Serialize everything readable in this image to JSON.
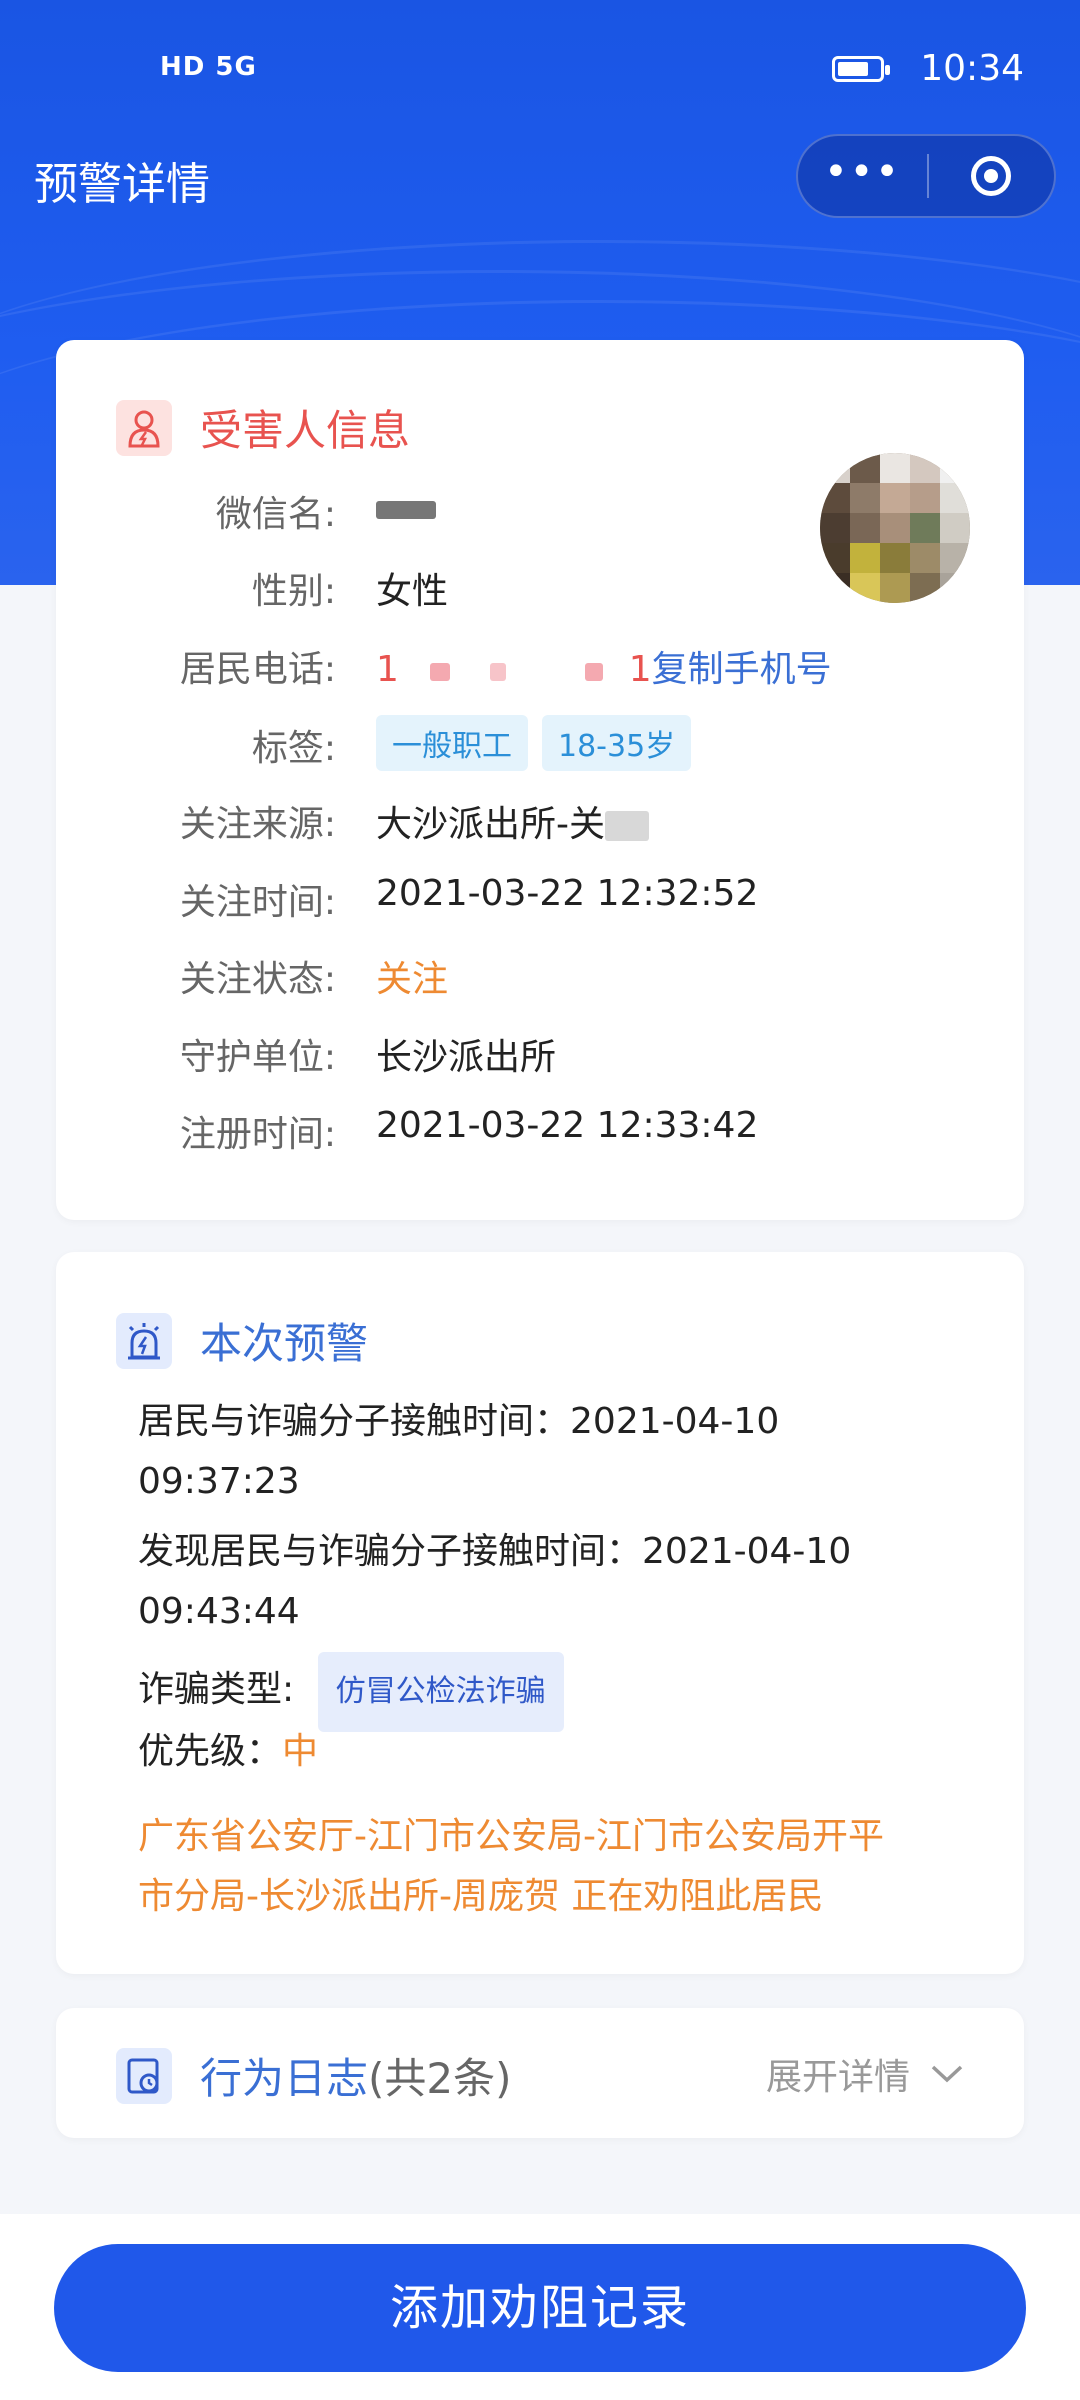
{
  "status_bar": {
    "network": "HD 5G",
    "time": "10:34"
  },
  "nav": {
    "title": "预警详情",
    "more_icon": "more-dots-icon",
    "target_icon": "mini-program-close-icon"
  },
  "victim_section": {
    "title": "受害人信息",
    "fields": [
      {
        "label": "微信名:",
        "value": ""
      },
      {
        "label": "性别:",
        "value": "女性"
      },
      {
        "label": "居民电话:",
        "value_prefix": "1",
        "value_suffix": "1",
        "copy_label": "复制手机号"
      },
      {
        "label": "标签:",
        "tags": [
          "一般职工",
          "18-35岁"
        ]
      },
      {
        "label": "关注来源:",
        "value": "大沙派出所-关"
      },
      {
        "label": "关注时间:",
        "value": "2021-03-22 12:32:52"
      },
      {
        "label": "关注状态:",
        "value": "关注"
      },
      {
        "label": "守护单位:",
        "value": "长沙派出所"
      },
      {
        "label": "注册时间:",
        "value": "2021-03-22 12:33:42"
      }
    ]
  },
  "alert_section": {
    "title": "本次预警",
    "contact_time_label": "居民与诈骗分子接触时间：",
    "contact_time_date": "2021-04-10",
    "contact_time_clock": "09:37:23",
    "found_time_label": "发现居民与诈骗分子接触时间：",
    "found_time_date": "2021-04-10",
    "found_time_clock": "09:43:44",
    "fraud_type_label": "诈骗类型:",
    "fraud_type": "仿冒公检法诈骗",
    "priority_label": "优先级：",
    "priority": "中",
    "notice_line1": "广东省公安厅-江门市公安局-江门市公安局开平",
    "notice_line2": "市分局-长沙派出所-周庞贺 正在劝阻此居民"
  },
  "log_section": {
    "title": "行为日志",
    "count": "(共2条)",
    "expand_label": "展开详情"
  },
  "footer": {
    "button_label": "添加劝阻记录"
  },
  "colors": {
    "header_blue": "#1f5df0",
    "primary_button": "#2058ea",
    "victim_accent": "#e8534f",
    "orange_status": "#ee8a32",
    "link_blue": "#3a6fd4"
  }
}
